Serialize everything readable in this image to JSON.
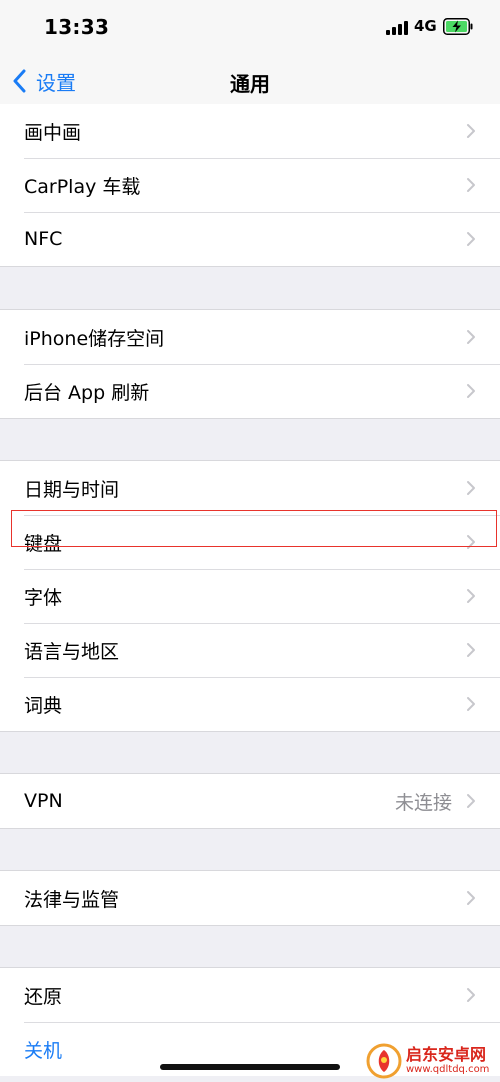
{
  "status_bar": {
    "time": "13:33",
    "network": "4G",
    "icons": [
      "signal-icon",
      "battery-charging-icon"
    ],
    "battery_color": "#4cd964"
  },
  "nav": {
    "back_label": "设置",
    "title": "通用",
    "accent_color": "#1a7cf5"
  },
  "groups": [
    {
      "items": [
        {
          "label": "画中画"
        },
        {
          "label": "CarPlay 车载"
        },
        {
          "label": "NFC"
        }
      ]
    },
    {
      "items": [
        {
          "label": "iPhone储存空间"
        },
        {
          "label": "后台 App 刷新"
        }
      ]
    },
    {
      "items": [
        {
          "label": "日期与时间"
        },
        {
          "label": "键盘",
          "highlighted": true
        },
        {
          "label": "字体"
        },
        {
          "label": "语言与地区"
        },
        {
          "label": "词典"
        }
      ]
    },
    {
      "items": [
        {
          "label": "VPN",
          "value": "未连接"
        }
      ]
    },
    {
      "items": [
        {
          "label": "法律与监管"
        }
      ]
    },
    {
      "items": [
        {
          "label": "还原"
        },
        {
          "label": "关机",
          "style": "link"
        }
      ]
    }
  ],
  "highlight_color": "#e8332c",
  "watermark": {
    "name": "启东安卓网",
    "url": "www.qdltdq.com"
  }
}
